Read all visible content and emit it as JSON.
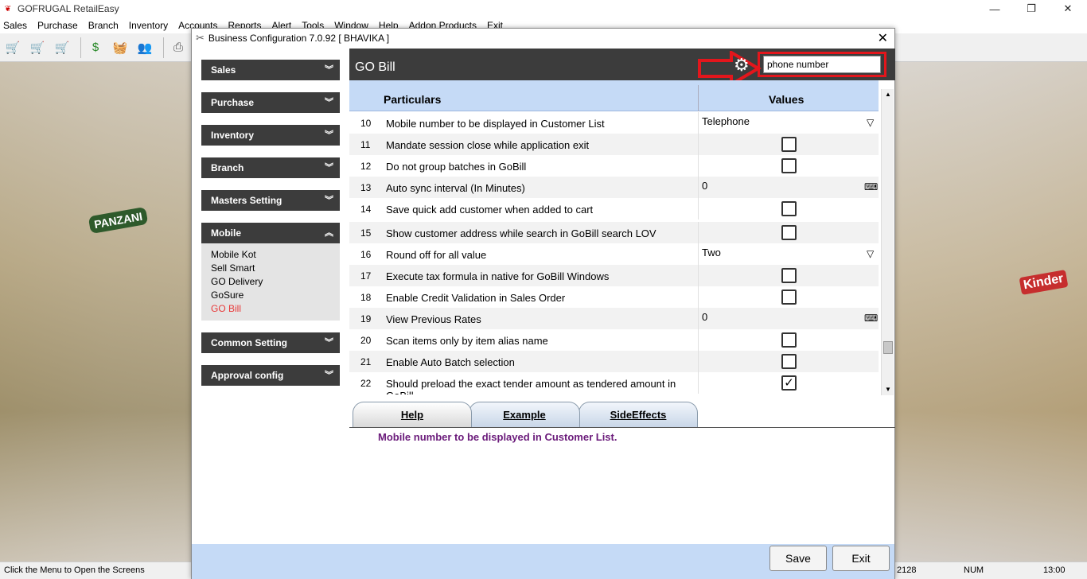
{
  "app": {
    "title": "GOFRUGAL RetailEasy",
    "logo_icon": "retaileasy-logo-icon",
    "window_controls": {
      "minimize": "—",
      "restore": "❐",
      "close": "✕"
    }
  },
  "menu": [
    "Sales",
    "Purchase",
    "Branch",
    "Inventory",
    "Accounts",
    "Reports",
    "Alert",
    "Tools",
    "Window",
    "Help",
    "Addon Products",
    "Exit"
  ],
  "toolbar": {
    "icons": [
      "cart-add-icon",
      "cart-add-icon",
      "cart-add-icon",
      "money-icon",
      "basket-icon",
      "users-icon",
      "printer-icon"
    ]
  },
  "status_bar": {
    "message": "Click the Menu to Open the Screens",
    "code": "2128",
    "num": "NUM",
    "time": "13:00"
  },
  "dialog": {
    "title": "Business Configuration 7.0.92 [ BHAVIKA ]",
    "close": "✕",
    "sidebar": {
      "sections": [
        {
          "label": "Sales",
          "expanded": false
        },
        {
          "label": "Purchase",
          "expanded": false
        },
        {
          "label": "Inventory",
          "expanded": false
        },
        {
          "label": "Branch",
          "expanded": false
        },
        {
          "label": "Masters Setting",
          "expanded": false
        },
        {
          "label": "Mobile",
          "expanded": true
        },
        {
          "label": "Common Setting",
          "expanded": false
        },
        {
          "label": "Approval config",
          "expanded": false
        }
      ],
      "mobile_items": [
        "Mobile Kot",
        "Sell Smart",
        "GO Delivery",
        "GoSure",
        "GO Bill"
      ],
      "active_item": "GO Bill"
    },
    "main": {
      "title": "GO Bill",
      "search_value": "phone number",
      "columns": {
        "particulars": "Particulars",
        "values": "Values"
      },
      "rows": [
        {
          "num": "10",
          "label": "Mobile number to be displayed in Customer List",
          "type": "dropdown",
          "value": "Telephone"
        },
        {
          "num": "11",
          "label": "Mandate session close while application exit",
          "type": "checkbox",
          "checked": false
        },
        {
          "num": "12",
          "label": "Do not group batches in GoBill",
          "type": "checkbox",
          "checked": false
        },
        {
          "num": "13",
          "label": "Auto sync interval (In Minutes)",
          "type": "number",
          "value": "0"
        },
        {
          "num": "14",
          "label": "Save quick add customer when added to cart",
          "type": "checkbox",
          "checked": false
        },
        {
          "num": "15",
          "label": "Show customer address while search in GoBill search LOV",
          "type": "checkbox",
          "checked": false
        },
        {
          "num": "16",
          "label": "Round off for all value",
          "type": "dropdown",
          "value": "Two"
        },
        {
          "num": "17",
          "label": "Execute tax formula in native for GoBill Windows",
          "type": "checkbox",
          "checked": false
        },
        {
          "num": "18",
          "label": "Enable Credit Validation in Sales Order",
          "type": "checkbox",
          "checked": false
        },
        {
          "num": "19",
          "label": "View Previous Rates",
          "type": "number",
          "value": "0"
        },
        {
          "num": "20",
          "label": "Scan items only by item alias name",
          "type": "checkbox",
          "checked": false
        },
        {
          "num": "21",
          "label": "Enable Auto Batch selection",
          "type": "checkbox",
          "checked": false
        },
        {
          "num": "22",
          "label": "Should preload the exact tender amount as tendered amount in GoBill",
          "type": "checkbox",
          "checked": true
        }
      ],
      "tabs": [
        "Help",
        "Example",
        "SideEffects"
      ],
      "active_tab": "Help",
      "help_text": "Mobile number to be displayed in Customer List.",
      "buttons": {
        "save": "Save",
        "exit": "Exit"
      }
    }
  },
  "colors": {
    "header_dark": "#3c3c3c",
    "grid_header": "#c5daf6",
    "active_item": "#e83a3a",
    "highlight": "#e3161c",
    "help_text": "#6a1a7a"
  }
}
